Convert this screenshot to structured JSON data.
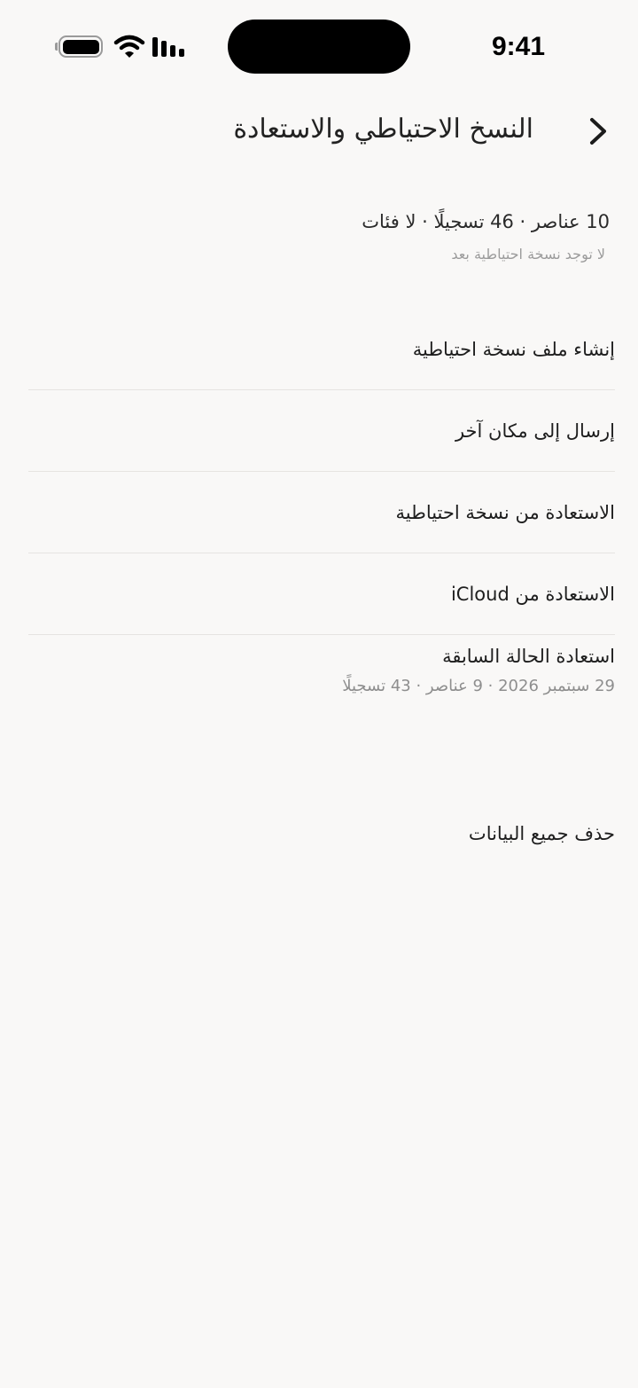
{
  "status_bar": {
    "time": "9:41",
    "icons": [
      "battery-icon",
      "wifi-icon",
      "cellular-signal-icon"
    ]
  },
  "header": {
    "title": "النسخ الاحتياطي والاستعادة",
    "back_icon": "chevron-icon"
  },
  "summary": {
    "stats": "10 عناصر · 46 تسجيلًا · لا فئات",
    "no_backup": "لا توجد نسخة احتياطية بعد"
  },
  "menu": {
    "items": [
      {
        "label": "إنشاء ملف نسخة احتياطية"
      },
      {
        "label": "إرسال إلى مكان آخر"
      },
      {
        "label": "الاستعادة من نسخة احتياطية"
      },
      {
        "label": "الاستعادة من iCloud"
      },
      {
        "label": "استعادة الحالة السابقة",
        "sub": "29 سبتمبر 2026 · 9 عناصر · 43 تسجيلًا"
      }
    ]
  },
  "danger": {
    "delete_all": "حذف جميع البيانات"
  },
  "colors": {
    "background": "#f9f8f7",
    "divider": "#e6e4e1",
    "secondary_text": "#8e8e8e"
  }
}
